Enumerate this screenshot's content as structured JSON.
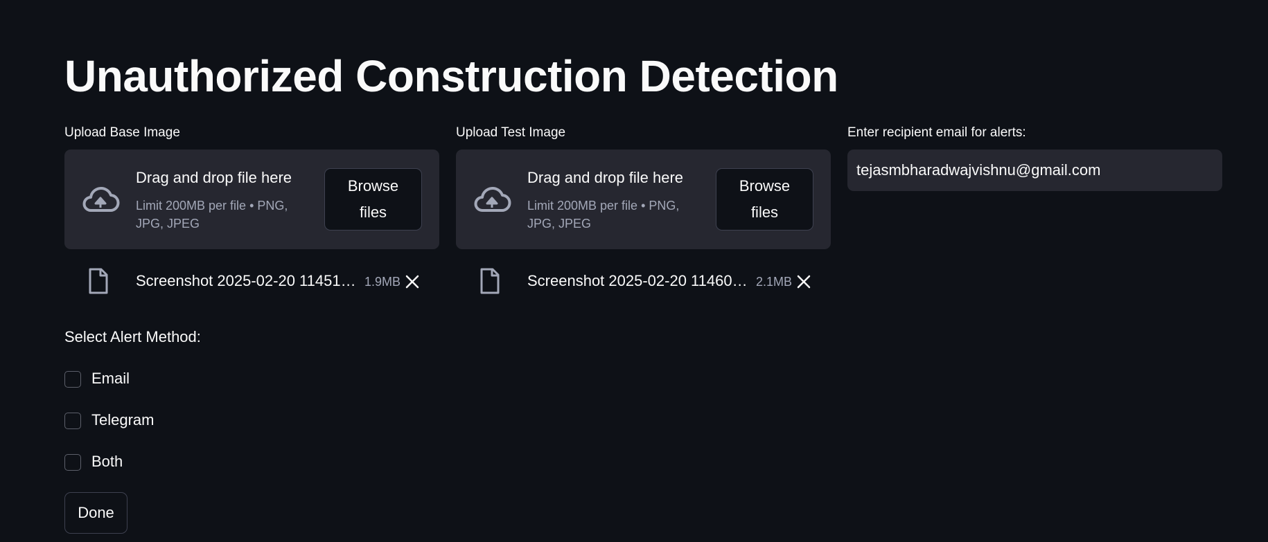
{
  "page": {
    "title": "Unauthorized Construction Detection"
  },
  "base_upload": {
    "label": "Upload Base Image",
    "drop_title": "Drag and drop file here",
    "limit_text": "Limit 200MB per file • PNG, JPG, JPEG",
    "browse_label": "Browse files",
    "file": {
      "name": "Screenshot 2025-02-20 11451…",
      "size": "1.9MB"
    }
  },
  "test_upload": {
    "label": "Upload Test Image",
    "drop_title": "Drag and drop file here",
    "limit_text": "Limit 200MB per file • PNG, JPG, JPEG",
    "browse_label": "Browse files",
    "file": {
      "name": "Screenshot 2025-02-20 11460…",
      "size": "2.1MB"
    }
  },
  "email": {
    "label": "Enter recipient email for alerts:",
    "value": "tejasmbharadwajvishnu@gmail.com"
  },
  "alert_method": {
    "label": "Select Alert Method:",
    "options": [
      {
        "label": "Email",
        "checked": false
      },
      {
        "label": "Telegram",
        "checked": false
      },
      {
        "label": "Both",
        "checked": false
      }
    ]
  },
  "done_button": {
    "label": "Done"
  },
  "colors": {
    "background": "#0e1117",
    "widget": "#262730",
    "text": "#fafafa",
    "muted": "#a3a8b8"
  },
  "icons": {
    "upload": "cloud-upload-icon",
    "file": "file-icon",
    "remove": "close-icon"
  }
}
